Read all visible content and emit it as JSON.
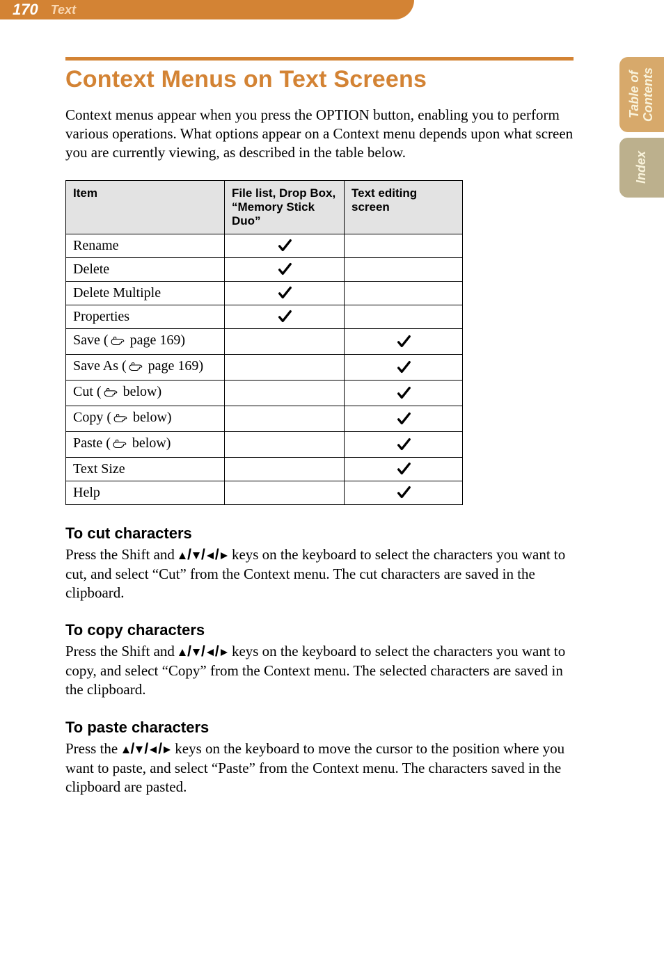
{
  "header": {
    "page_number": "170",
    "section": "Text"
  },
  "side_tabs": {
    "toc": "Table of\nContents",
    "index": "Index"
  },
  "title": "Context Menus on Text Screens",
  "intro": "Context menus appear when you press the OPTION button, enabling you to perform various operations. What options appear on a Context menu depends upon what screen you are currently viewing, as described in the table below.",
  "table": {
    "headers": {
      "item": "Item",
      "col_a": "File list, Drop Box, “Memory Stick Duo”",
      "col_b": "Text editing screen"
    },
    "rows": [
      {
        "label": "Rename",
        "ref": null,
        "a": true,
        "b": false
      },
      {
        "label": "Delete",
        "ref": null,
        "a": true,
        "b": false
      },
      {
        "label": "Delete Multiple",
        "ref": null,
        "a": true,
        "b": false
      },
      {
        "label": "Properties",
        "ref": null,
        "a": true,
        "b": false
      },
      {
        "label": "Save",
        "ref": "page 169",
        "a": false,
        "b": true
      },
      {
        "label": "Save As",
        "ref": "page 169",
        "a": false,
        "b": true
      },
      {
        "label": "Cut",
        "ref": "below",
        "a": false,
        "b": true
      },
      {
        "label": "Copy",
        "ref": "below",
        "a": false,
        "b": true
      },
      {
        "label": "Paste",
        "ref": "below",
        "a": false,
        "b": true
      },
      {
        "label": "Text Size",
        "ref": null,
        "a": false,
        "b": true
      },
      {
        "label": "Help",
        "ref": null,
        "a": false,
        "b": true
      }
    ]
  },
  "sections": [
    {
      "heading": "To cut characters",
      "prefix": "Press the Shift and ",
      "suffix": " keys on the keyboard to select the characters you want to cut, and select “Cut” from the Context menu. The cut characters are saved in the clipboard."
    },
    {
      "heading": "To copy characters",
      "prefix": "Press the Shift and ",
      "suffix": " keys on the keyboard to select the characters you want to copy, and select “Copy” from the Context menu. The selected characters are saved in the clipboard."
    },
    {
      "heading": "To paste characters",
      "prefix": "Press the ",
      "suffix": " keys on the keyboard to move the cursor to the position where you want to paste, and select “Paste” from the Context menu. The characters saved in the clipboard are pasted."
    }
  ]
}
